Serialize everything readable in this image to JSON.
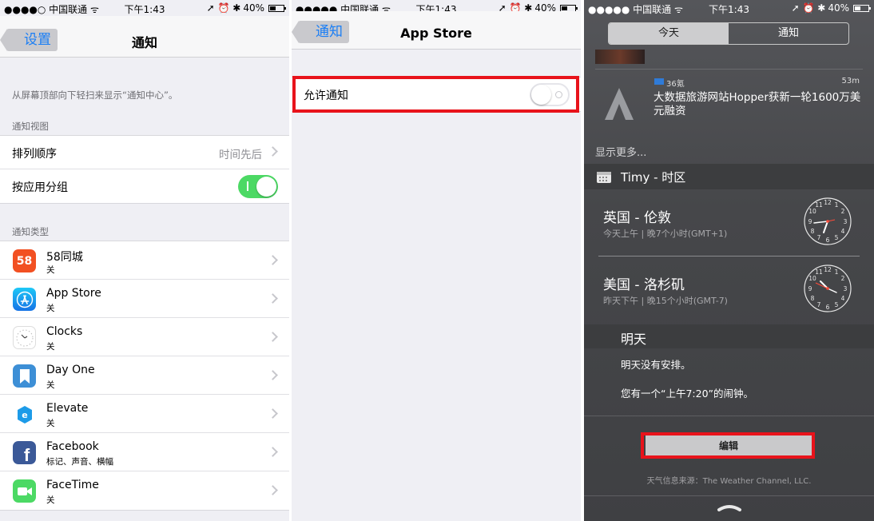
{
  "status_bar": {
    "carrier": "●●●●○ 中国联通 ᯤ",
    "carrier_full": "●●●●● 中国联通 ᯤ",
    "time": "下午1:43",
    "indicators": "➚ ⏰ ✱",
    "battery": "40%"
  },
  "panel1": {
    "back_label": "设置",
    "title": "通知",
    "hint": "从屏幕顶部向下轻扫来显示“通知中心”。",
    "view_header": "通知视图",
    "sort_label": "排列顺序",
    "sort_value": "时间先后",
    "group_label": "按应用分组",
    "group_toggle": "on",
    "types_header": "通知类型",
    "apps": [
      {
        "name": "58同城",
        "sub": "关",
        "icon": "58-app-icon",
        "color": "#f25022"
      },
      {
        "name": "App Store",
        "sub": "关",
        "icon": "app-store-icon",
        "color": "#1e8cf0"
      },
      {
        "name": "Clocks",
        "sub": "关",
        "icon": "clocks-app-icon",
        "color": "#ffffff"
      },
      {
        "name": "Day One",
        "sub": "关",
        "icon": "day-one-icon",
        "color": "#3d8fd6"
      },
      {
        "name": "Elevate",
        "sub": "关",
        "icon": "elevate-icon",
        "color": "#1d9be8"
      },
      {
        "name": "Facebook",
        "sub": "标记、声音、横幅",
        "icon": "facebook-icon",
        "color": "#3b5998"
      },
      {
        "name": "FaceTime",
        "sub": "关",
        "icon": "facetime-icon",
        "color": "#4cd964"
      }
    ]
  },
  "panel2": {
    "back_label": "通知",
    "title": "App Store",
    "allow_label": "允许通知",
    "allow_toggle": "off"
  },
  "panel3": {
    "tab_today": "今天",
    "tab_notifications": "通知",
    "news_source": "36氪",
    "news_age": "53m",
    "news_headline": "大数据旅游网站Hopper获新一轮1600万美元融资",
    "show_more": "显示更多...",
    "widget_title": "Timy - 时区",
    "clocks": [
      {
        "city": "英国 - 伦敦",
        "detail": "今天上午 | 晚7个小时(GMT+1)"
      },
      {
        "city": "美国 - 洛杉矶",
        "detail": "昨天下午 | 晚15个小时(GMT-7)"
      }
    ],
    "tomorrow_header": "明天",
    "no_events": "明天没有安排。",
    "alarm_note": "您有一个“上午7:20”的闹钟。",
    "edit_label": "编辑",
    "weather_source": "天气信息来源：The Weather Channel, LLC."
  }
}
